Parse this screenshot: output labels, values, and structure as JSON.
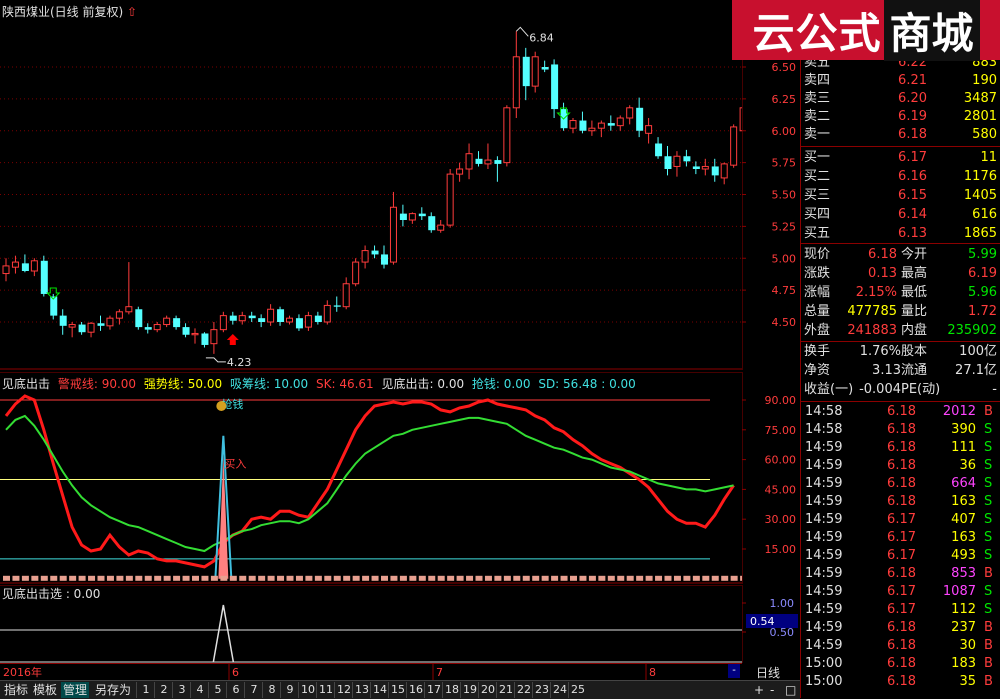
{
  "title": {
    "stock": "陕西煤业(日线 前复权)"
  },
  "main_chart": {
    "high_label": "6.84",
    "low_label": "4.23",
    "price_axis": [
      "6.50",
      "6.25",
      "6.00",
      "5.75",
      "5.50",
      "5.25",
      "5.00",
      "4.75",
      "4.50"
    ]
  },
  "ind1": {
    "name": "见底出击",
    "legend": [
      {
        "label": "警戒线: 90.00",
        "color": "#ff3c3c"
      },
      {
        "label": "强势线: 50.00",
        "color": "#ffff00"
      },
      {
        "label": "吸筹线: 10.00",
        "color": "#40e0e0"
      },
      {
        "label": "SK: 46.61",
        "color": "#ff3c3c"
      },
      {
        "label": "见底出击: 0.00",
        "color": "#e0e0e0"
      },
      {
        "label": "抢钱: 0.00",
        "color": "#40e0e0"
      },
      {
        "label": "SD: 56.48 : 0.00",
        "color": "#40e0e0"
      }
    ],
    "axis": [
      "90.00",
      "75.00",
      "60.00",
      "45.00",
      "30.00",
      "15.00"
    ],
    "annotation_qiangqian": "抢钱",
    "annotation_mairu": "买入",
    "money_icon": "money-bag-icon"
  },
  "ind2": {
    "legend": "见底出击选 : 0.00",
    "axis": [
      "1.00",
      "0.50"
    ],
    "current_value": "0.54"
  },
  "date_axis": {
    "year": "2016年",
    "m6": "6",
    "m7": "7",
    "m8": "8",
    "period": "日线"
  },
  "bottom_tabs": [
    "指标",
    "模板",
    "管理",
    "另存为"
  ],
  "page_numbers": [
    "1",
    "2",
    "3",
    "4",
    "5",
    "6",
    "7",
    "8",
    "9",
    "10",
    "11",
    "12",
    "13",
    "14",
    "15",
    "16",
    "17",
    "18",
    "19",
    "20",
    "21",
    "22",
    "23",
    "24",
    "25"
  ],
  "bottom_right": [
    "+",
    "-",
    "□"
  ],
  "logo": {
    "part1": "云公式",
    "part2": "商城"
  },
  "order_book": {
    "asks": [
      {
        "label": "卖五",
        "price": "6.22",
        "vol": "883"
      },
      {
        "label": "卖四",
        "price": "6.21",
        "vol": "190"
      },
      {
        "label": "卖三",
        "price": "6.20",
        "vol": "3487"
      },
      {
        "label": "卖二",
        "price": "6.19",
        "vol": "2801"
      },
      {
        "label": "卖一",
        "price": "6.18",
        "vol": "580"
      }
    ],
    "bids": [
      {
        "label": "买一",
        "price": "6.17",
        "vol": "11"
      },
      {
        "label": "买二",
        "price": "6.16",
        "vol": "1176"
      },
      {
        "label": "买三",
        "price": "6.15",
        "vol": "1405"
      },
      {
        "label": "买四",
        "price": "6.14",
        "vol": "616"
      },
      {
        "label": "买五",
        "price": "6.13",
        "vol": "1865"
      }
    ]
  },
  "stats": [
    {
      "l1": "现价",
      "v1": "6.18",
      "c1": "red",
      "l2": "今开",
      "v2": "5.99",
      "c2": "green"
    },
    {
      "l1": "涨跌",
      "v1": "0.13",
      "c1": "red",
      "l2": "最高",
      "v2": "6.19",
      "c2": "red"
    },
    {
      "l1": "涨幅",
      "v1": "2.15%",
      "c1": "red",
      "l2": "最低",
      "v2": "5.96",
      "c2": "green"
    },
    {
      "l1": "总量",
      "v1": "477785",
      "c1": "yellow",
      "l2": "量比",
      "v2": "1.72",
      "c2": "red"
    },
    {
      "l1": "外盘",
      "v1": "241883",
      "c1": "red",
      "l2": "内盘",
      "v2": "235902",
      "c2": "green"
    }
  ],
  "stats2": [
    {
      "l1": "换手",
      "v1": "1.76%",
      "l2": "股本",
      "v2": "100亿"
    },
    {
      "l1": "净资",
      "v1": "3.13",
      "l2": "流通",
      "v2": "27.1亿"
    },
    {
      "l1": "收益(一)",
      "v1": "-0.004",
      "l2": "PE(动)",
      "v2": "-"
    }
  ],
  "ticks": [
    {
      "t": "14:58",
      "p": "6.18",
      "v": "2012",
      "f": "B",
      "vc": "magenta"
    },
    {
      "t": "14:58",
      "p": "6.18",
      "v": "390",
      "f": "S",
      "vc": "yellow"
    },
    {
      "t": "14:59",
      "p": "6.18",
      "v": "111",
      "f": "S",
      "vc": "yellow"
    },
    {
      "t": "14:59",
      "p": "6.18",
      "v": "36",
      "f": "S",
      "vc": "yellow"
    },
    {
      "t": "14:59",
      "p": "6.18",
      "v": "664",
      "f": "S",
      "vc": "magenta"
    },
    {
      "t": "14:59",
      "p": "6.18",
      "v": "163",
      "f": "S",
      "vc": "yellow"
    },
    {
      "t": "14:59",
      "p": "6.17",
      "v": "407",
      "f": "S",
      "vc": "yellow"
    },
    {
      "t": "14:59",
      "p": "6.17",
      "v": "163",
      "f": "S",
      "vc": "yellow"
    },
    {
      "t": "14:59",
      "p": "6.17",
      "v": "493",
      "f": "S",
      "vc": "yellow"
    },
    {
      "t": "14:59",
      "p": "6.18",
      "v": "853",
      "f": "B",
      "vc": "magenta"
    },
    {
      "t": "14:59",
      "p": "6.17",
      "v": "1087",
      "f": "S",
      "vc": "magenta"
    },
    {
      "t": "14:59",
      "p": "6.17",
      "v": "112",
      "f": "S",
      "vc": "yellow"
    },
    {
      "t": "14:59",
      "p": "6.18",
      "v": "237",
      "f": "B",
      "vc": "yellow"
    },
    {
      "t": "14:59",
      "p": "6.18",
      "v": "30",
      "f": "B",
      "vc": "yellow"
    },
    {
      "t": "15:00",
      "p": "6.18",
      "v": "183",
      "f": "B",
      "vc": "yellow"
    },
    {
      "t": "15:00",
      "p": "6.18",
      "v": "35",
      "f": "B",
      "vc": "yellow"
    }
  ],
  "candles": [
    {
      "o": 4.88,
      "h": 5.0,
      "l": 4.82,
      "c": 4.94
    },
    {
      "o": 4.93,
      "h": 5.02,
      "l": 4.88,
      "c": 4.97
    },
    {
      "o": 4.96,
      "h": 5.03,
      "l": 4.89,
      "c": 4.9
    },
    {
      "o": 4.9,
      "h": 5.0,
      "l": 4.86,
      "c": 4.98
    },
    {
      "o": 4.98,
      "h": 5.02,
      "l": 4.7,
      "c": 4.72
    },
    {
      "o": 4.7,
      "h": 4.72,
      "l": 4.52,
      "c": 4.55
    },
    {
      "o": 4.55,
      "h": 4.6,
      "l": 4.4,
      "c": 4.47
    },
    {
      "o": 4.46,
      "h": 4.5,
      "l": 4.38,
      "c": 4.48
    },
    {
      "o": 4.48,
      "h": 4.5,
      "l": 4.4,
      "c": 4.42
    },
    {
      "o": 4.42,
      "h": 4.5,
      "l": 4.38,
      "c": 4.49
    },
    {
      "o": 4.49,
      "h": 4.55,
      "l": 4.43,
      "c": 4.47
    },
    {
      "o": 4.47,
      "h": 4.55,
      "l": 4.44,
      "c": 4.53
    },
    {
      "o": 4.53,
      "h": 4.6,
      "l": 4.48,
      "c": 4.58
    },
    {
      "o": 4.58,
      "h": 4.97,
      "l": 4.56,
      "c": 4.62
    },
    {
      "o": 4.6,
      "h": 4.62,
      "l": 4.44,
      "c": 4.46
    },
    {
      "o": 4.46,
      "h": 4.49,
      "l": 4.41,
      "c": 4.44
    },
    {
      "o": 4.44,
      "h": 4.5,
      "l": 4.42,
      "c": 4.48
    },
    {
      "o": 4.48,
      "h": 4.55,
      "l": 4.46,
      "c": 4.53
    },
    {
      "o": 4.53,
      "h": 4.55,
      "l": 4.44,
      "c": 4.46
    },
    {
      "o": 4.46,
      "h": 4.49,
      "l": 4.38,
      "c": 4.4
    },
    {
      "o": 4.4,
      "h": 4.45,
      "l": 4.33,
      "c": 4.41
    },
    {
      "o": 4.41,
      "h": 4.42,
      "l": 4.3,
      "c": 4.32
    },
    {
      "o": 4.33,
      "h": 4.5,
      "l": 4.25,
      "c": 4.44
    },
    {
      "o": 4.44,
      "h": 4.58,
      "l": 4.42,
      "c": 4.55
    },
    {
      "o": 4.55,
      "h": 4.58,
      "l": 4.48,
      "c": 4.51
    },
    {
      "o": 4.51,
      "h": 4.58,
      "l": 4.48,
      "c": 4.55
    },
    {
      "o": 4.55,
      "h": 4.58,
      "l": 4.5,
      "c": 4.53
    },
    {
      "o": 4.53,
      "h": 4.56,
      "l": 4.46,
      "c": 4.5
    },
    {
      "o": 4.5,
      "h": 4.64,
      "l": 4.47,
      "c": 4.6
    },
    {
      "o": 4.6,
      "h": 4.62,
      "l": 4.47,
      "c": 4.5
    },
    {
      "o": 4.5,
      "h": 4.55,
      "l": 4.48,
      "c": 4.53
    },
    {
      "o": 4.53,
      "h": 4.56,
      "l": 4.43,
      "c": 4.45
    },
    {
      "o": 4.46,
      "h": 4.58,
      "l": 4.43,
      "c": 4.55
    },
    {
      "o": 4.55,
      "h": 4.58,
      "l": 4.48,
      "c": 4.5
    },
    {
      "o": 4.5,
      "h": 4.67,
      "l": 4.48,
      "c": 4.63
    },
    {
      "o": 4.63,
      "h": 4.7,
      "l": 4.58,
      "c": 4.62
    },
    {
      "o": 4.62,
      "h": 4.85,
      "l": 4.6,
      "c": 4.8
    },
    {
      "o": 4.8,
      "h": 5.0,
      "l": 4.78,
      "c": 4.97
    },
    {
      "o": 4.97,
      "h": 5.1,
      "l": 4.92,
      "c": 5.06
    },
    {
      "o": 5.06,
      "h": 5.1,
      "l": 5.0,
      "c": 5.03
    },
    {
      "o": 5.03,
      "h": 5.1,
      "l": 4.92,
      "c": 4.95
    },
    {
      "o": 4.97,
      "h": 5.52,
      "l": 4.95,
      "c": 5.4
    },
    {
      "o": 5.35,
      "h": 5.42,
      "l": 5.25,
      "c": 5.3
    },
    {
      "o": 5.3,
      "h": 5.36,
      "l": 5.27,
      "c": 5.35
    },
    {
      "o": 5.35,
      "h": 5.4,
      "l": 5.3,
      "c": 5.33
    },
    {
      "o": 5.33,
      "h": 5.36,
      "l": 5.2,
      "c": 5.22
    },
    {
      "o": 5.22,
      "h": 5.3,
      "l": 5.2,
      "c": 5.26
    },
    {
      "o": 5.26,
      "h": 5.7,
      "l": 5.24,
      "c": 5.66
    },
    {
      "o": 5.66,
      "h": 5.75,
      "l": 5.6,
      "c": 5.7
    },
    {
      "o": 5.7,
      "h": 5.9,
      "l": 5.62,
      "c": 5.82
    },
    {
      "o": 5.78,
      "h": 5.84,
      "l": 5.72,
      "c": 5.74
    },
    {
      "o": 5.74,
      "h": 5.9,
      "l": 5.7,
      "c": 5.77
    },
    {
      "o": 5.77,
      "h": 5.8,
      "l": 5.6,
      "c": 5.74
    },
    {
      "o": 5.75,
      "h": 6.2,
      "l": 5.72,
      "c": 6.18
    },
    {
      "o": 6.18,
      "h": 6.78,
      "l": 6.1,
      "c": 6.58
    },
    {
      "o": 6.58,
      "h": 6.65,
      "l": 6.24,
      "c": 6.35
    },
    {
      "o": 6.35,
      "h": 6.62,
      "l": 6.3,
      "c": 6.58
    },
    {
      "o": 6.5,
      "h": 6.55,
      "l": 6.46,
      "c": 6.48
    },
    {
      "o": 6.52,
      "h": 6.56,
      "l": 6.1,
      "c": 6.17
    },
    {
      "o": 6.17,
      "h": 6.22,
      "l": 6.0,
      "c": 6.02
    },
    {
      "o": 6.02,
      "h": 6.1,
      "l": 5.98,
      "c": 6.08
    },
    {
      "o": 6.08,
      "h": 6.15,
      "l": 5.98,
      "c": 6.0
    },
    {
      "o": 6.0,
      "h": 6.08,
      "l": 5.96,
      "c": 6.02
    },
    {
      "o": 6.02,
      "h": 6.08,
      "l": 5.95,
      "c": 6.06
    },
    {
      "o": 6.06,
      "h": 6.12,
      "l": 6.0,
      "c": 6.04
    },
    {
      "o": 6.04,
      "h": 6.12,
      "l": 6.0,
      "c": 6.1
    },
    {
      "o": 6.1,
      "h": 6.2,
      "l": 6.05,
      "c": 6.18
    },
    {
      "o": 6.18,
      "h": 6.26,
      "l": 5.95,
      "c": 6.0
    },
    {
      "o": 5.98,
      "h": 6.1,
      "l": 5.9,
      "c": 6.04
    },
    {
      "o": 5.9,
      "h": 5.95,
      "l": 5.78,
      "c": 5.8
    },
    {
      "o": 5.8,
      "h": 5.88,
      "l": 5.65,
      "c": 5.7
    },
    {
      "o": 5.72,
      "h": 5.84,
      "l": 5.64,
      "c": 5.8
    },
    {
      "o": 5.8,
      "h": 5.85,
      "l": 5.72,
      "c": 5.76
    },
    {
      "o": 5.72,
      "h": 5.76,
      "l": 5.66,
      "c": 5.7
    },
    {
      "o": 5.7,
      "h": 5.78,
      "l": 5.65,
      "c": 5.72
    },
    {
      "o": 5.72,
      "h": 5.78,
      "l": 5.6,
      "c": 5.65
    },
    {
      "o": 5.63,
      "h": 5.75,
      "l": 5.58,
      "c": 5.74
    },
    {
      "o": 5.73,
      "h": 6.05,
      "l": 5.71,
      "c": 6.03
    },
    {
      "o": 6.0,
      "h": 6.22,
      "l": 5.97,
      "c": 6.18
    }
  ]
}
